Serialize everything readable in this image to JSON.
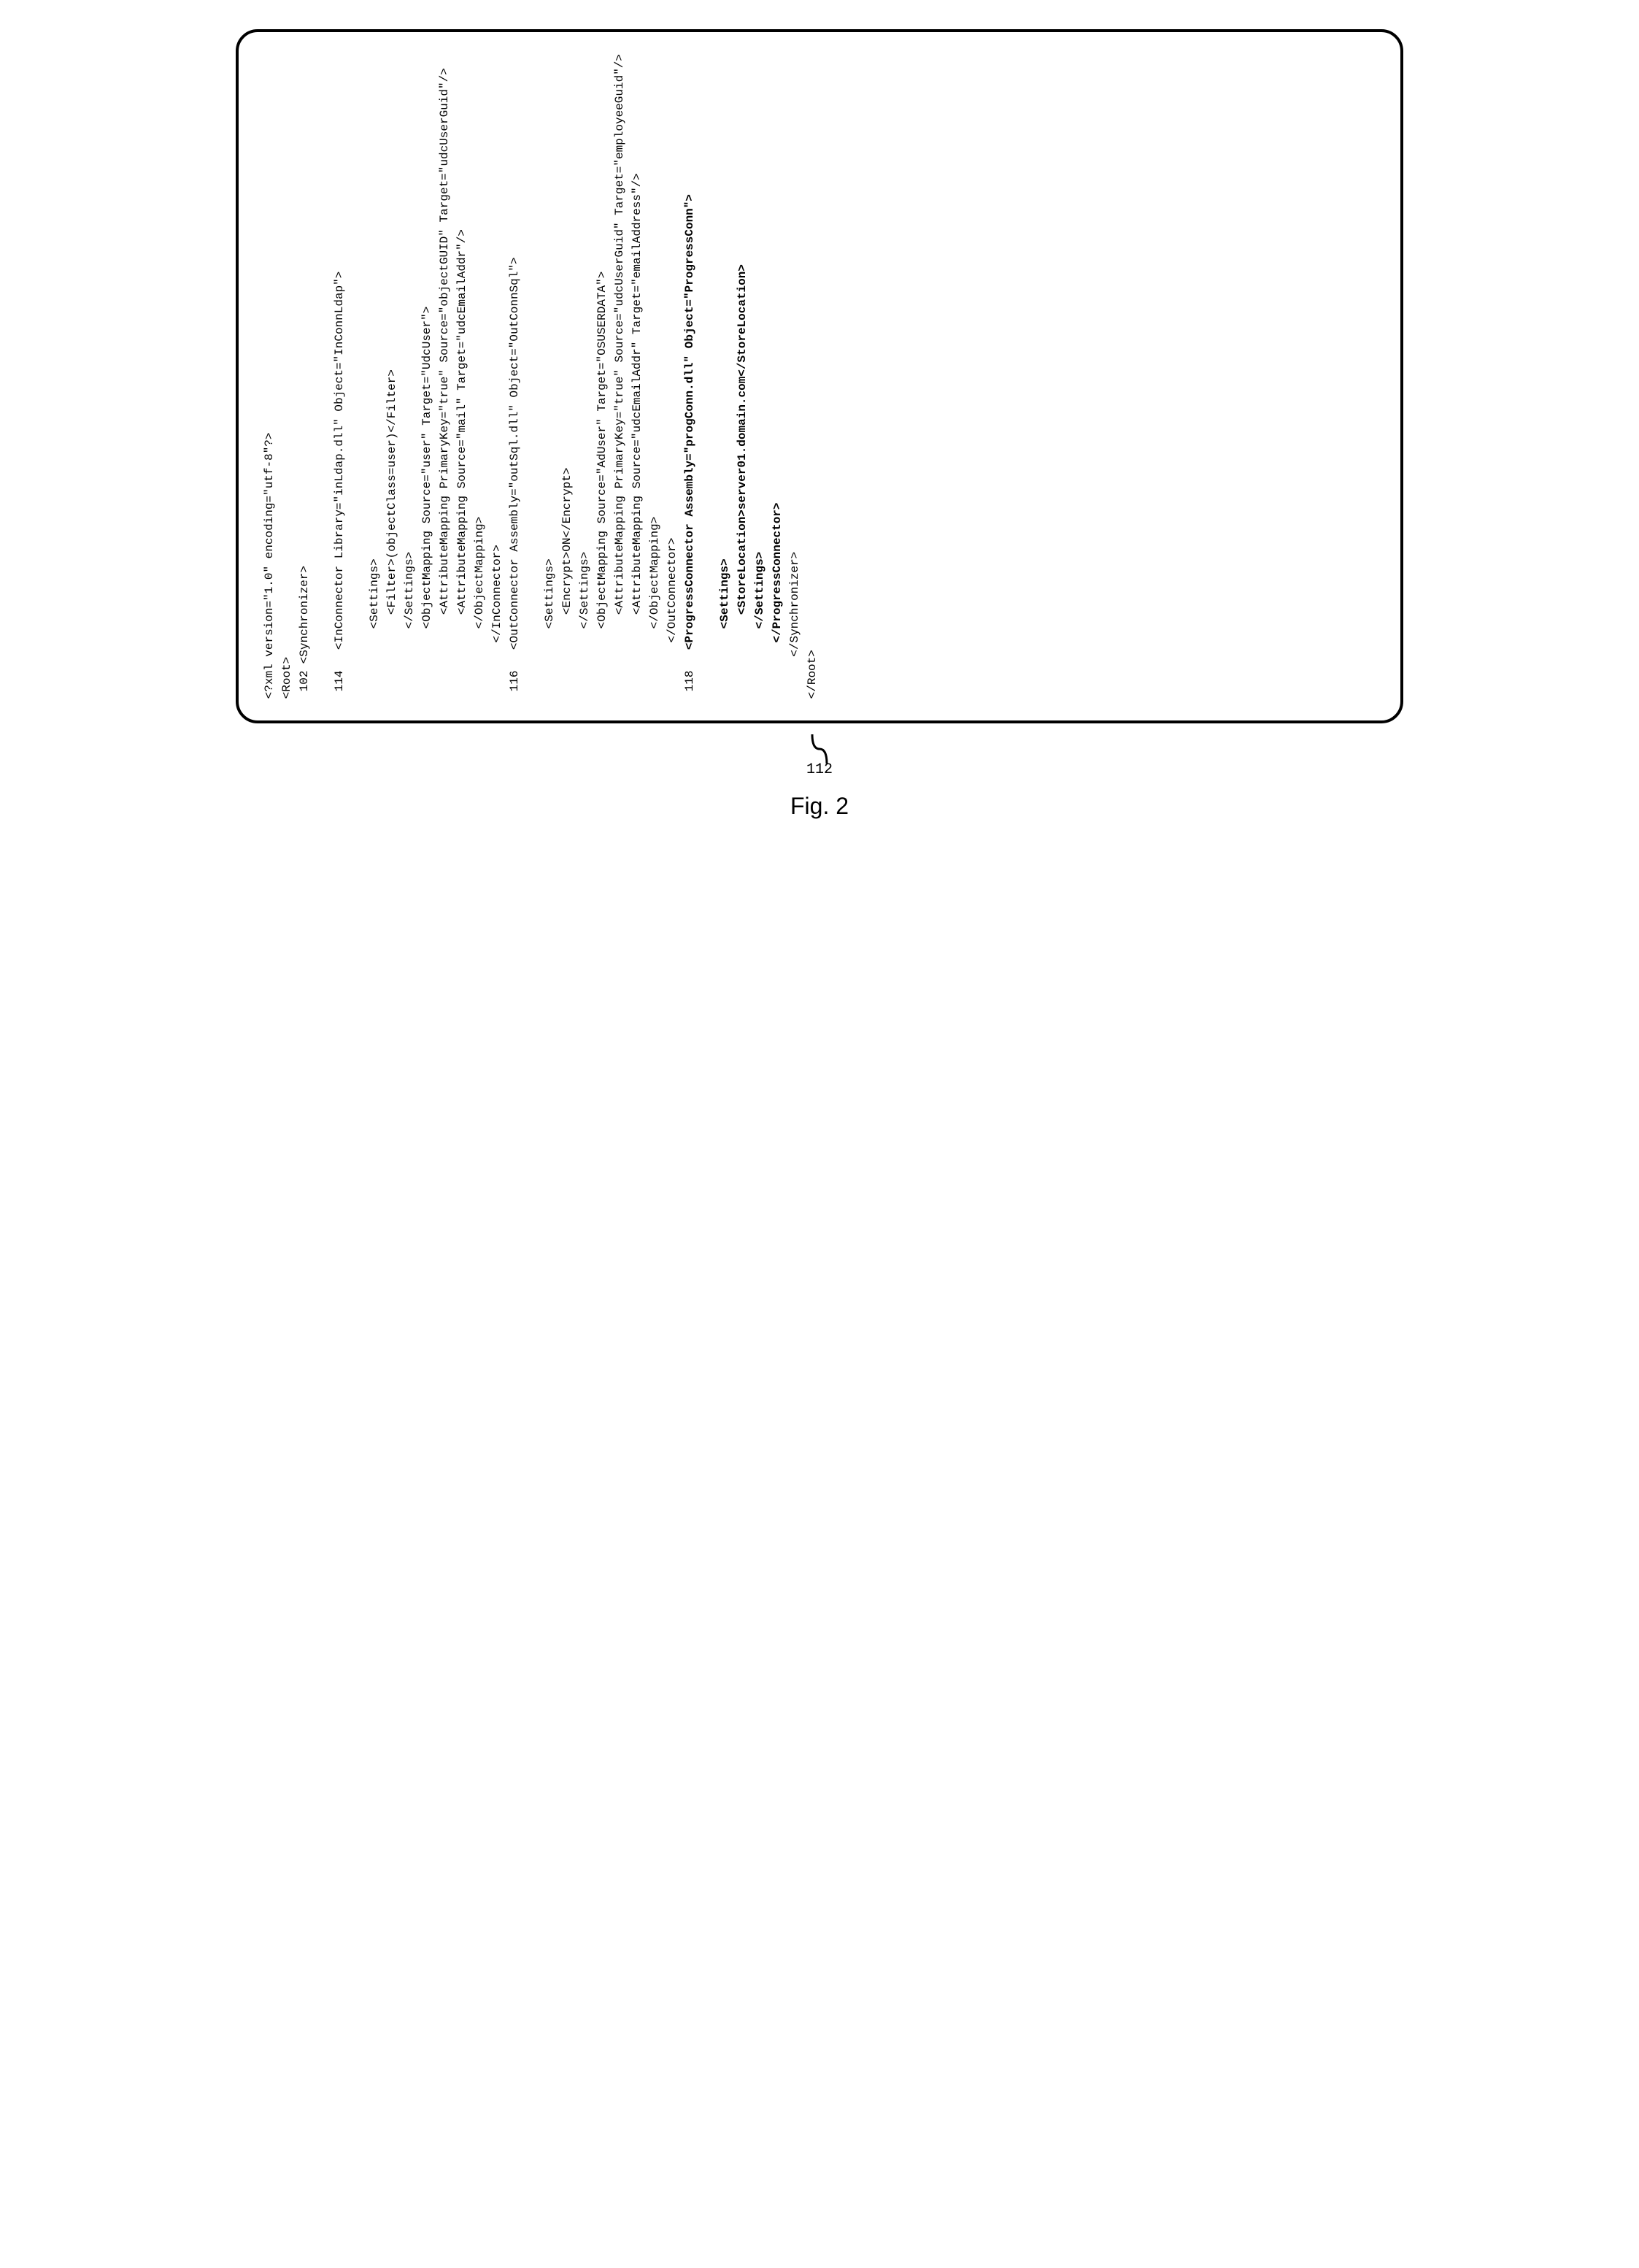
{
  "figure_label": "Fig. 2",
  "callout_num": "112",
  "ref_102": "102",
  "ref_114": "114",
  "ref_116": "116",
  "ref_118": "118",
  "xml": {
    "declaration": "<?xml version=\"1.0\" encoding=\"utf-8\"?>",
    "root_open": "<Root>",
    "sync_open": "<Synchronizer>",
    "inconn_open": "<InConnector Library=\"inLdap.dll\" Object=\"InConnLdap\">",
    "settings_open": "<Settings>",
    "filter": "<Filter>(objectClass=user)</Filter>",
    "settings_close": "</Settings>",
    "objmap_in_open": "<ObjectMapping Source=\"user\" Target=\"UdcUser\">",
    "attrmap_in_1": "<AttributeMapping PrimaryKey=\"true\" Source=\"objectGUID\" Target=\"udcUserGuid\"/>",
    "attrmap_in_2": "<AttributeMapping Source=\"mail\" Target=\"udcEmailAddr\"/>",
    "objmap_close": "</ObjectMapping>",
    "inconn_close": "</InConnector>",
    "outconn_open": "<OutConnector Assembly=\"outSql.dll\" Object=\"OutConnSql\">",
    "encrypt": "<Encrypt>ON</Encrypt>",
    "objmap_out_open": "<ObjectMapping Source=\"AdUser\" Target=\"OSUSERDATA\">",
    "attrmap_out_1": "<AttributeMapping PrimaryKey=\"true\" Source=\"udcUserGuid\" Target=\"employeeGuid\"/>",
    "attrmap_out_2": "<AttributeMapping Source=\"udcEmailAddr\" Target=\"emailAddress\"/>",
    "outconn_close": "</OutConnector>",
    "progconn_open": "<ProgressConnector Assembly=\"progConn.dll\" Object=\"ProgressConn\">",
    "storeloc": "<StoreLocation>server01.domain.com</StoreLocation>",
    "progconn_close": "</ProgressConnector>",
    "sync_close": "</Synchronizer>",
    "root_close": "</Root>"
  }
}
